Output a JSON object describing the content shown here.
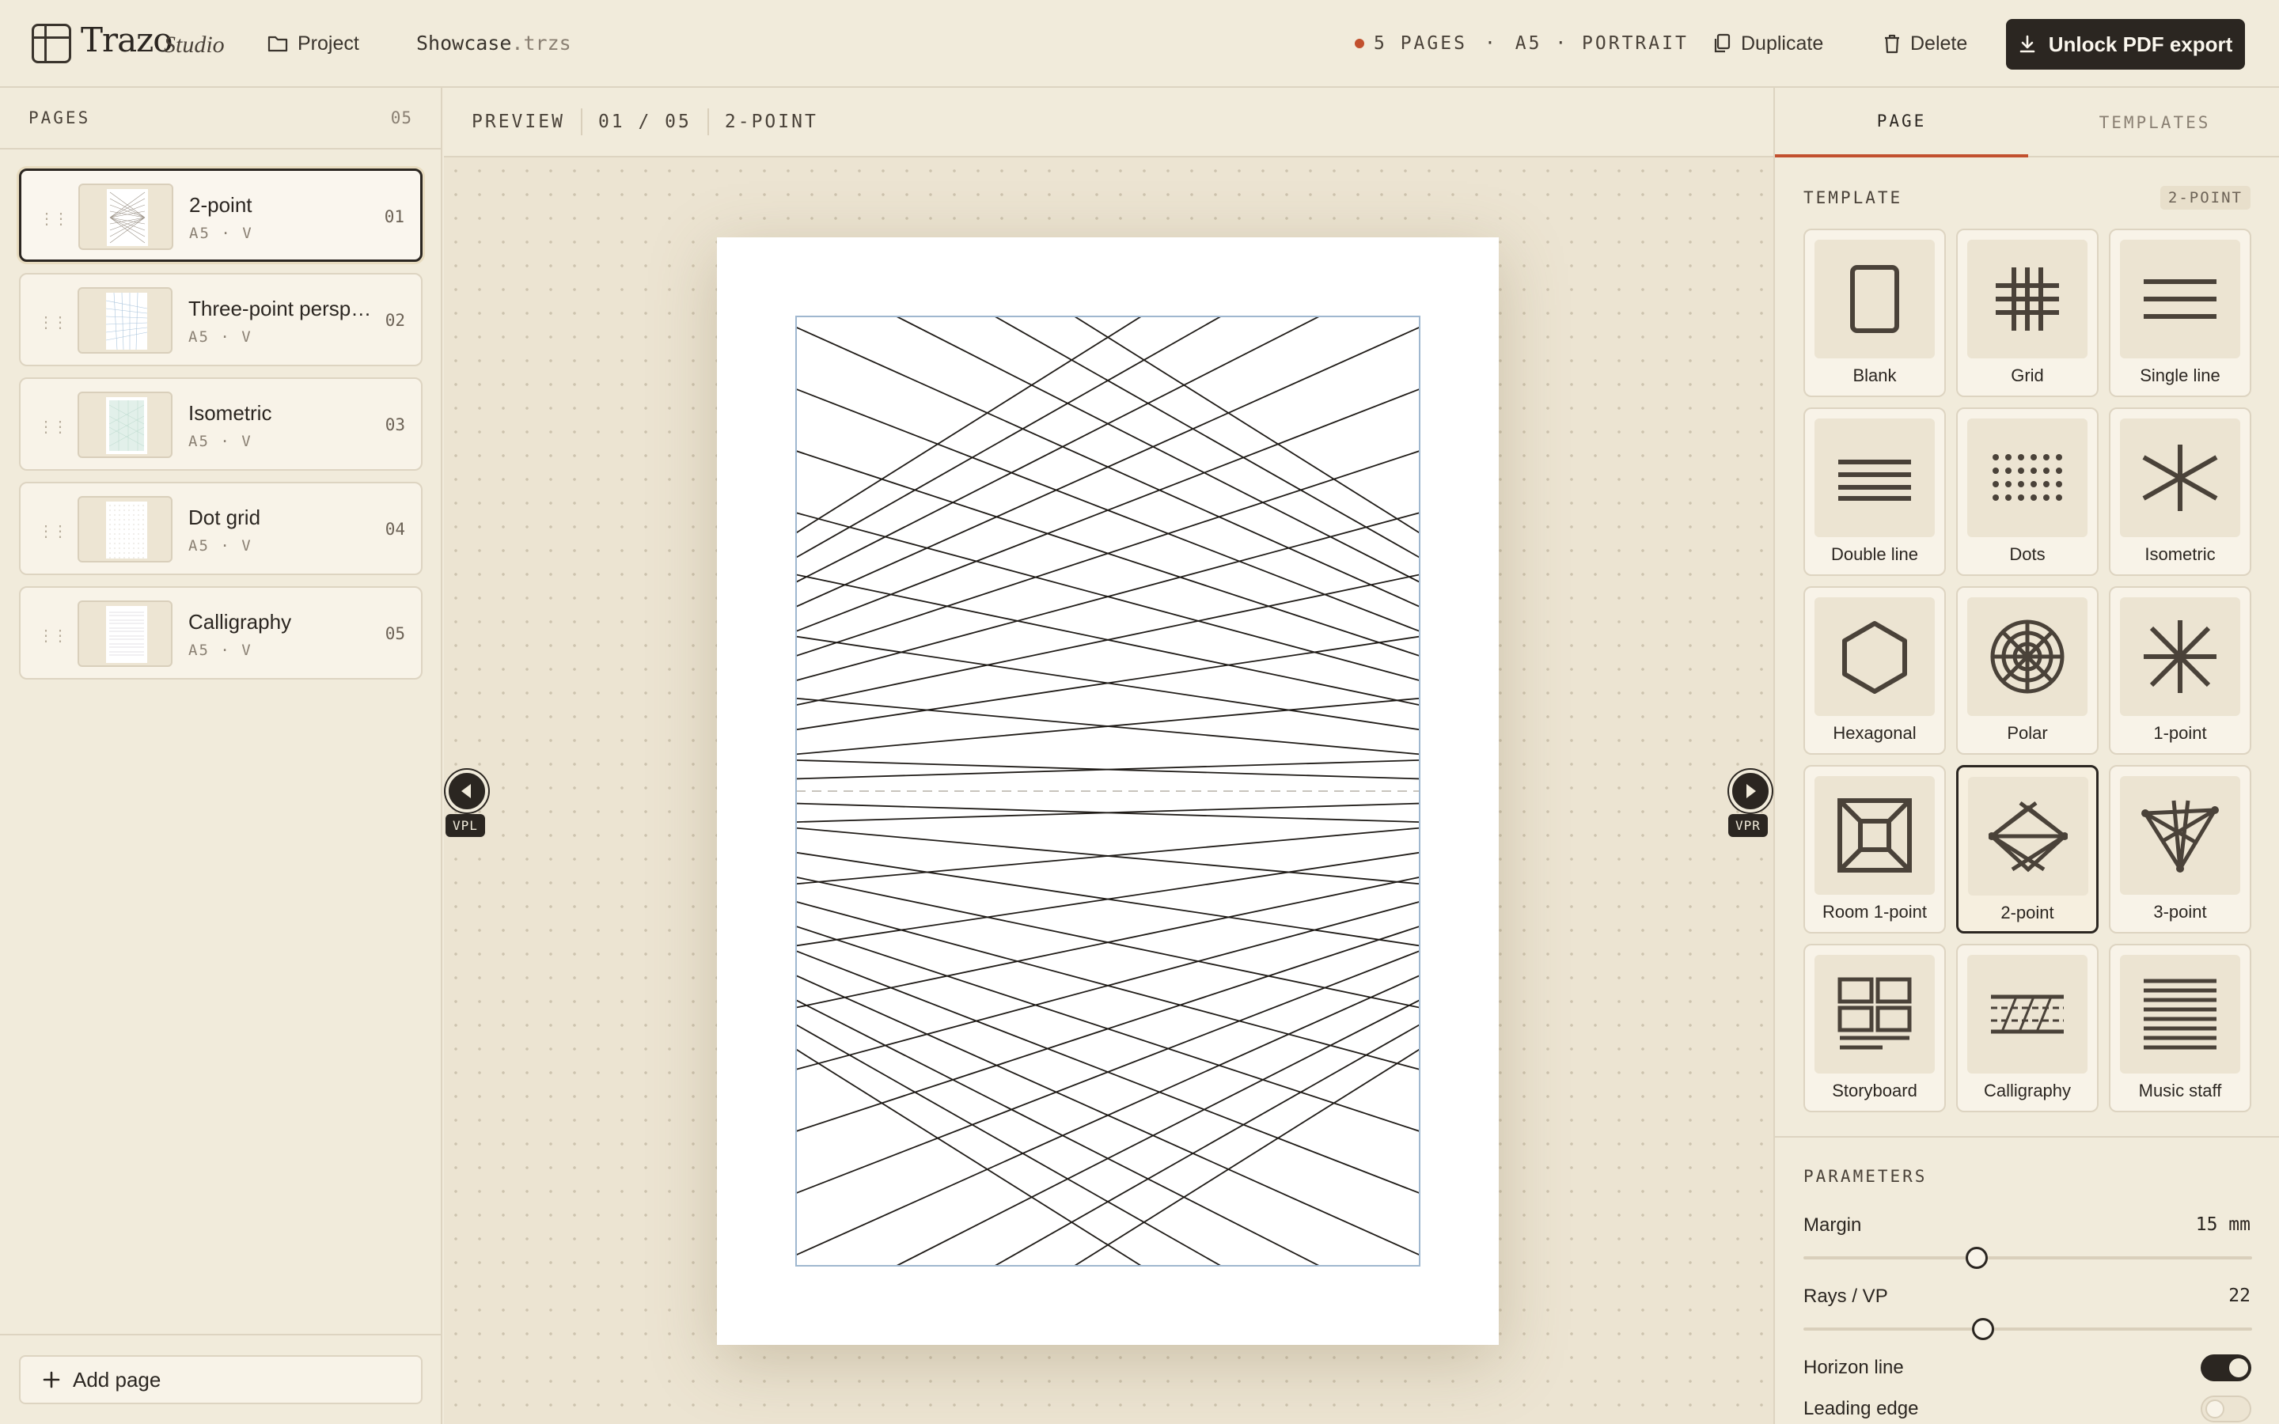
{
  "app": {
    "name": "Trazo",
    "sub": "Studio"
  },
  "topbar": {
    "project_label": "Project",
    "file_name": "Showcase",
    "file_ext": ".trzs",
    "pages_meta": "5 PAGES",
    "size_meta": "A5 · PORTRAIT",
    "duplicate_label": "Duplicate",
    "delete_label": "Delete",
    "unlock_label": "Unlock PDF export"
  },
  "sidebar": {
    "title": "PAGES",
    "count": "05",
    "pages": [
      {
        "title": "2-point",
        "sub": "A5 · V",
        "num": "01"
      },
      {
        "title": "Three-point perspe…",
        "sub": "A5 · V",
        "num": "02"
      },
      {
        "title": "Isometric",
        "sub": "A5 · V",
        "num": "03"
      },
      {
        "title": "Dot grid",
        "sub": "A5 · V",
        "num": "04"
      },
      {
        "title": "Calligraphy",
        "sub": "A5 · V",
        "num": "05"
      }
    ],
    "add_page_label": "Add page"
  },
  "preview": {
    "label": "PREVIEW",
    "page_index": "01 / 05",
    "template": "2-POINT",
    "vp_left": "VPL",
    "vp_right": "VPR"
  },
  "panel": {
    "tabs": [
      "PAGE",
      "TEMPLATES"
    ],
    "template_title": "TEMPLATE",
    "template_chip": "2-POINT",
    "templates": [
      {
        "label": "Blank",
        "icon": "blank-icon"
      },
      {
        "label": "Grid",
        "icon": "grid-icon"
      },
      {
        "label": "Single line",
        "icon": "single-line-icon"
      },
      {
        "label": "Double line",
        "icon": "double-line-icon"
      },
      {
        "label": "Dots",
        "icon": "dots-icon"
      },
      {
        "label": "Isometric",
        "icon": "isometric-icon"
      },
      {
        "label": "Hexagonal",
        "icon": "hexagon-icon"
      },
      {
        "label": "Polar",
        "icon": "polar-icon"
      },
      {
        "label": "1-point",
        "icon": "one-point-icon"
      },
      {
        "label": "Room 1-point",
        "icon": "room-one-point-icon"
      },
      {
        "label": "2-point",
        "icon": "two-point-icon"
      },
      {
        "label": "3-point",
        "icon": "three-point-icon"
      },
      {
        "label": "Storyboard",
        "icon": "storyboard-icon"
      },
      {
        "label": "Calligraphy",
        "icon": "calligraphy-icon"
      },
      {
        "label": "Music staff",
        "icon": "music-staff-icon"
      }
    ],
    "selected_template": "2-point",
    "parameters_title": "PARAMETERS",
    "params": {
      "margin_label": "Margin",
      "margin_value": "15 mm",
      "margin_level": 0.38,
      "rays_label": "Rays / VP",
      "rays_value": "22",
      "rays_level": 0.395,
      "horizon_label": "Horizon line",
      "horizon_on": true,
      "leading_label": "Leading edge",
      "leading_on": false
    }
  },
  "colors": {
    "accent": "#c2502e",
    "ink": "#2b2621",
    "bg": "#f1ebdb"
  }
}
